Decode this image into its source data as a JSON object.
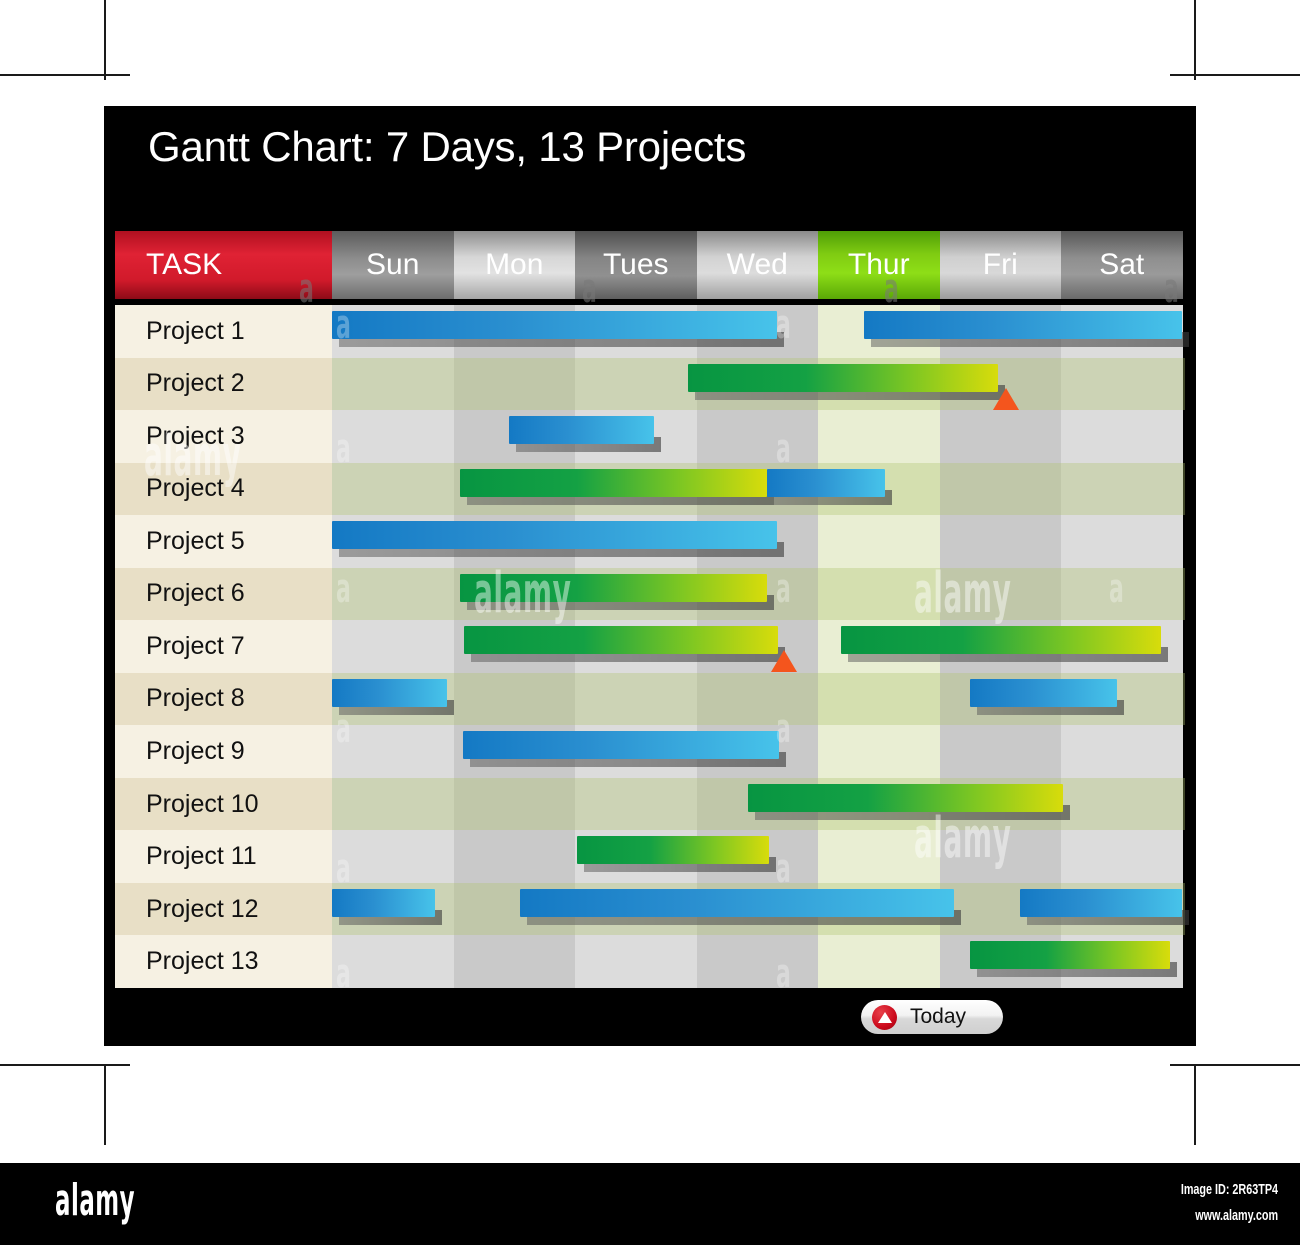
{
  "chart_data": {
    "type": "bar",
    "chart_kind": "gantt",
    "title": "Gantt Chart: 7 Days, 13 Projects",
    "xlabel": "",
    "ylabel": "TASK",
    "grid": true,
    "legend_position": "bottom-right",
    "categories": [
      "Sun",
      "Mon",
      "Tues",
      "Wed",
      "Thur",
      "Fri",
      "Sat"
    ],
    "day_count": 7,
    "project_count": 13,
    "today_column": "Thur",
    "today_column_index": 4,
    "tasks": [
      "Project 1",
      "Project 2",
      "Project 3",
      "Project 4",
      "Project 5",
      "Project 6",
      "Project 7",
      "Project 8",
      "Project 9",
      "Project 10",
      "Project 11",
      "Project 12",
      "Project 13"
    ],
    "bars": [
      {
        "task": "Project 1",
        "row": 0,
        "color": "blue",
        "start_day": 0.0,
        "end_day": 3.66
      },
      {
        "task": "Project 1",
        "row": 0,
        "color": "blue",
        "start_day": 4.38,
        "end_day": 7.0
      },
      {
        "task": "Project 2",
        "row": 1,
        "color": "green",
        "start_day": 2.93,
        "end_day": 5.48
      },
      {
        "task": "Project 3",
        "row": 2,
        "color": "blue",
        "start_day": 1.46,
        "end_day": 2.65
      },
      {
        "task": "Project 4",
        "row": 3,
        "color": "green",
        "start_day": 1.05,
        "end_day": 3.58
      },
      {
        "task": "Project 4",
        "row": 3,
        "color": "blue",
        "start_day": 3.58,
        "end_day": 4.55
      },
      {
        "task": "Project 5",
        "row": 4,
        "color": "blue",
        "start_day": 0.0,
        "end_day": 3.66
      },
      {
        "task": "Project 6",
        "row": 5,
        "color": "green",
        "start_day": 1.05,
        "end_day": 3.58
      },
      {
        "task": "Project 7",
        "row": 6,
        "color": "green",
        "start_day": 1.09,
        "end_day": 3.67
      },
      {
        "task": "Project 7",
        "row": 6,
        "color": "green",
        "start_day": 4.19,
        "end_day": 6.82
      },
      {
        "task": "Project 8",
        "row": 7,
        "color": "blue",
        "start_day": 0.0,
        "end_day": 0.95
      },
      {
        "task": "Project 8",
        "row": 7,
        "color": "blue",
        "start_day": 5.25,
        "end_day": 6.46
      },
      {
        "task": "Project 9",
        "row": 8,
        "color": "blue",
        "start_day": 1.08,
        "end_day": 3.68
      },
      {
        "task": "Project 10",
        "row": 9,
        "color": "green",
        "start_day": 3.42,
        "end_day": 6.02
      },
      {
        "task": "Project 11",
        "row": 10,
        "color": "green",
        "start_day": 2.02,
        "end_day": 3.6
      },
      {
        "task": "Project 12",
        "row": 11,
        "color": "blue",
        "start_day": 0.0,
        "end_day": 0.85
      },
      {
        "task": "Project 12",
        "row": 11,
        "color": "blue",
        "start_day": 1.55,
        "end_day": 5.12
      },
      {
        "task": "Project 12",
        "row": 11,
        "color": "blue",
        "start_day": 5.66,
        "end_day": 7.0
      },
      {
        "task": "Project 13",
        "row": 12,
        "color": "green",
        "start_day": 5.25,
        "end_day": 6.9
      }
    ],
    "today_markers": [
      {
        "task": "Project 2",
        "row": 1,
        "day": 5.55
      },
      {
        "task": "Project 7",
        "row": 6,
        "day": 3.72
      }
    ]
  },
  "header": {
    "task_label": "TASK",
    "days": [
      "Sun",
      "Mon",
      "Tues",
      "Wed",
      "Thur",
      "Fri",
      "Sat"
    ]
  },
  "rows": [
    {
      "label": "Project 1"
    },
    {
      "label": "Project 2"
    },
    {
      "label": "Project 3"
    },
    {
      "label": "Project 4"
    },
    {
      "label": "Project 5"
    },
    {
      "label": "Project 6"
    },
    {
      "label": "Project 7"
    },
    {
      "label": "Project 8"
    },
    {
      "label": "Project 9"
    },
    {
      "label": "Project 10"
    },
    {
      "label": "Project 11"
    },
    {
      "label": "Project 12"
    },
    {
      "label": "Project 13"
    }
  ],
  "today_button": {
    "label": "Today",
    "icon": "triangle-up-icon"
  },
  "colors": {
    "task_header_red": "#d11a2b",
    "today_header_green": "#8ede17",
    "bar_blue_start": "#1479c4",
    "bar_blue_end": "#47c3ea",
    "bar_green_start": "#079542",
    "bar_green_end": "#d8dc0b",
    "marker_orange": "#f4551d",
    "label_row_light": "#f6f1e3",
    "label_row_dark": "#e8dfc6",
    "panel_black": "#000000",
    "today_column_tint": "#e9eed3"
  },
  "watermark": {
    "letter": "a",
    "word": "alamy",
    "logo": "alamy",
    "image_id": "Image ID: 2R63TP4",
    "url": "www.alamy.com"
  }
}
